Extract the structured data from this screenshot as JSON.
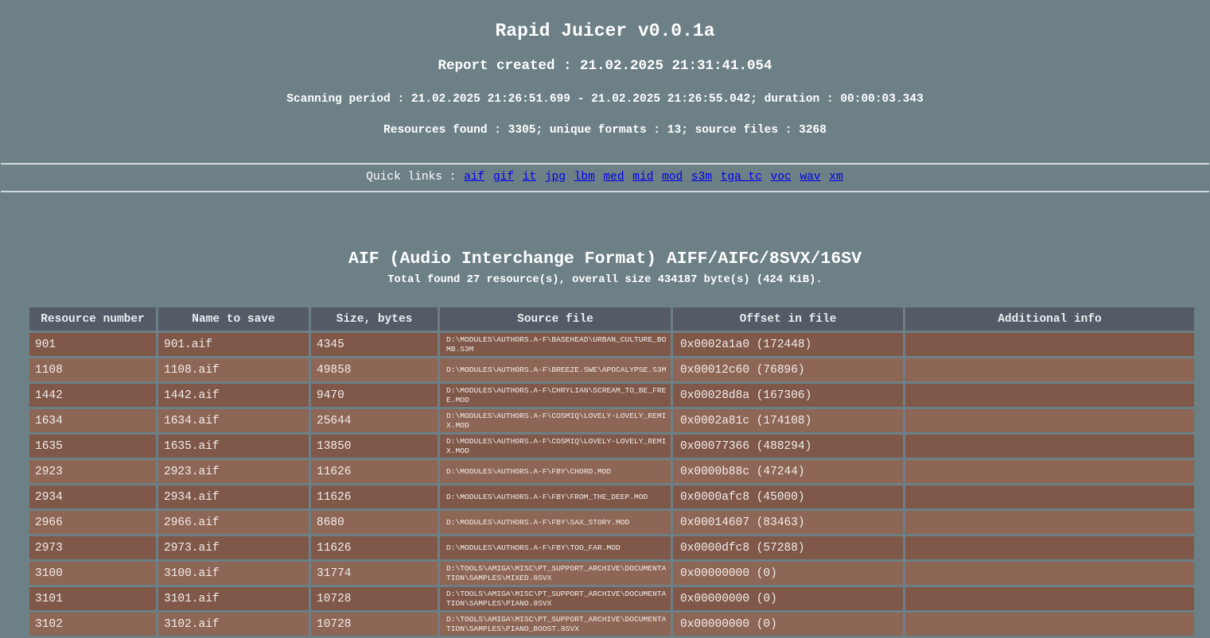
{
  "header": {
    "title": "Rapid Juicer v0.0.1a",
    "report_created": "Report created : 21.02.2025 21:31:41.054",
    "scanning_period": "Scanning period : 21.02.2025 21:26:51.699 - 21.02.2025 21:26:55.042; duration : 00:00:03.343",
    "resources_found": "Resources found : 3305; unique formats : 13; source files : 3268"
  },
  "quick_links": {
    "label": "Quick links :",
    "links": [
      "aif",
      "gif",
      "it",
      "jpg",
      "lbm",
      "med",
      "mid",
      "mod",
      "s3m",
      "tga_tc",
      "voc",
      "wav",
      "xm"
    ]
  },
  "section": {
    "title": "AIF (Audio Interchange Format) AIFF/AIFC/8SVX/16SV",
    "summary": "Total found 27 resource(s), overall size 434187 byte(s) (424 KiB).",
    "columns": [
      "Resource number",
      "Name to save",
      "Size, bytes",
      "Source file",
      "Offset in file",
      "Additional info"
    ],
    "rows": [
      {
        "number": "901",
        "name": "901.aif",
        "size": "4345",
        "source": "D:\\MODULES\\AUTHORS.A-F\\BASEHEAD\\URBAN_CULTURE_BOMB.S3M",
        "offset": "0x0002a1a0 (172448)",
        "info": ""
      },
      {
        "number": "1108",
        "name": "1108.aif",
        "size": "49858",
        "source": "D:\\MODULES\\AUTHORS.A-F\\BREEZE.SWE\\APOCALYPSE.S3M",
        "offset": "0x00012c60 (76896)",
        "info": ""
      },
      {
        "number": "1442",
        "name": "1442.aif",
        "size": "9470",
        "source": "D:\\MODULES\\AUTHORS.A-F\\CHRYLIAN\\SCREAM_TO_BE_FREE.MOD",
        "offset": "0x00028d8a (167306)",
        "info": ""
      },
      {
        "number": "1634",
        "name": "1634.aif",
        "size": "25644",
        "source": "D:\\MODULES\\AUTHORS.A-F\\COSMIQ\\LOVELY-LOVELY_REMIX.MOD",
        "offset": "0x0002a81c (174108)",
        "info": ""
      },
      {
        "number": "1635",
        "name": "1635.aif",
        "size": "13850",
        "source": "D:\\MODULES\\AUTHORS.A-F\\COSMIQ\\LOVELY-LOVELY_REMIX.MOD",
        "offset": "0x00077366 (488294)",
        "info": ""
      },
      {
        "number": "2923",
        "name": "2923.aif",
        "size": "11626",
        "source": "D:\\MODULES\\AUTHORS.A-F\\FBY\\CHORD.MOD",
        "offset": "0x0000b88c (47244)",
        "info": ""
      },
      {
        "number": "2934",
        "name": "2934.aif",
        "size": "11626",
        "source": "D:\\MODULES\\AUTHORS.A-F\\FBY\\FROM_THE_DEEP.MOD",
        "offset": "0x0000afc8 (45000)",
        "info": ""
      },
      {
        "number": "2966",
        "name": "2966.aif",
        "size": "8680",
        "source": "D:\\MODULES\\AUTHORS.A-F\\FBY\\SAX_STORY.MOD",
        "offset": "0x00014607 (83463)",
        "info": ""
      },
      {
        "number": "2973",
        "name": "2973.aif",
        "size": "11626",
        "source": "D:\\MODULES\\AUTHORS.A-F\\FBY\\TOO_FAR.MOD",
        "offset": "0x0000dfc8 (57288)",
        "info": ""
      },
      {
        "number": "3100",
        "name": "3100.aif",
        "size": "31774",
        "source": "D:\\TOOLS\\AMIGA\\MISC\\PT_SUPPORT_ARCHIVE\\DOCUMENTATION\\SAMPLES\\MIXED.8SVX",
        "offset": "0x00000000 (0)",
        "info": ""
      },
      {
        "number": "3101",
        "name": "3101.aif",
        "size": "10728",
        "source": "D:\\TOOLS\\AMIGA\\MISC\\PT_SUPPORT_ARCHIVE\\DOCUMENTATION\\SAMPLES\\PIANO.8SVX",
        "offset": "0x00000000 (0)",
        "info": ""
      },
      {
        "number": "3102",
        "name": "3102.aif",
        "size": "10728",
        "source": "D:\\TOOLS\\AMIGA\\MISC\\PT_SUPPORT_ARCHIVE\\DOCUMENTATION\\SAMPLES\\PIANO_BOOST.8SVX",
        "offset": "0x00000000 (0)",
        "info": ""
      }
    ]
  },
  "colors": {
    "background": "#6c8086",
    "header_cell": "#545a66",
    "row_odd": "#7f584a",
    "row_even": "#8e6656",
    "link": "#0000ee"
  }
}
